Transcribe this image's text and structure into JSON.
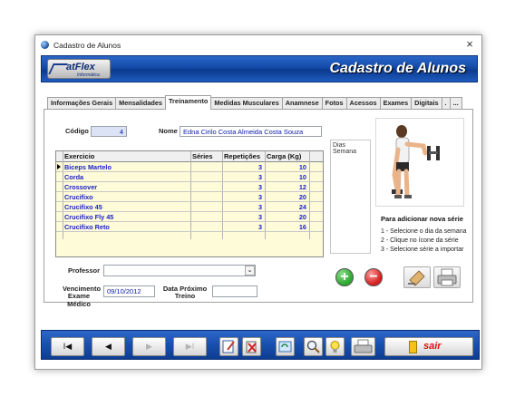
{
  "window": {
    "title": "Cadastro de Alunos",
    "close_glyph": "×"
  },
  "banner": {
    "logo_text": "atFlex",
    "logo_sub": "Informática",
    "title": "Cadastro de Alunos"
  },
  "tabs": [
    {
      "label": "Informações Gerais",
      "active": false
    },
    {
      "label": "Mensalidades",
      "active": false
    },
    {
      "label": "Treinamento",
      "active": true
    },
    {
      "label": "Medidas Musculares",
      "active": false
    },
    {
      "label": "Anamnese",
      "active": false
    },
    {
      "label": "Fotos",
      "active": false
    },
    {
      "label": "Acessos",
      "active": false
    },
    {
      "label": "Exames",
      "active": false
    },
    {
      "label": "Digitais",
      "active": false
    },
    {
      "label": ".",
      "active": false
    },
    {
      "label": "...",
      "active": false
    }
  ],
  "form": {
    "codigo_label": "Código",
    "codigo_value": "4",
    "nome_label": "Nome",
    "nome_value": "Edna Cirilo Costa Almeida Costa Souza",
    "dias_semana_label": "Dias Semana",
    "professor_label": "Professor",
    "professor_value": "",
    "vencimento_label_1": "Vencimento",
    "vencimento_label_2": "Exame Médico",
    "vencimento_value": "09/10/2012",
    "proximo_label_1": "Data Próximo",
    "proximo_label_2": "Treino",
    "proximo_value": ""
  },
  "grid": {
    "headers": {
      "exercicio": "Exercicio",
      "series": "Séries",
      "repeticoes": "Repetições",
      "carga": "Carga (Kg)"
    },
    "rows": [
      {
        "exercicio": "Biceps Martelo",
        "series": "",
        "repeticoes": "3",
        "carga": "10"
      },
      {
        "exercicio": "Corda",
        "series": "",
        "repeticoes": "3",
        "carga": "10"
      },
      {
        "exercicio": "Crossover",
        "series": "",
        "repeticoes": "3",
        "carga": "12"
      },
      {
        "exercicio": "Crucifixo",
        "series": "",
        "repeticoes": "3",
        "carga": "20"
      },
      {
        "exercicio": "Crucifixo 45",
        "series": "",
        "repeticoes": "3",
        "carga": "24"
      },
      {
        "exercicio": "Crucifixo Fly 45",
        "series": "",
        "repeticoes": "3",
        "carga": "20"
      },
      {
        "exercicio": "Crucifixo Reto",
        "series": "",
        "repeticoes": "3",
        "carga": "16"
      }
    ]
  },
  "info": {
    "title": "Para adicionar nova série",
    "steps": [
      "1 - Selecione o dia da semana",
      "2 - Clique no ícone da série",
      "3 - Selecione série a importar"
    ]
  },
  "actions": {
    "add_glyph": "+",
    "remove_glyph": "−"
  },
  "nav": {
    "first": "I◀",
    "prev": "◀",
    "next": "▶",
    "last": "▶I",
    "exit": "sair"
  },
  "colors": {
    "banner_blue": "#134aa8",
    "grid_bg": "#fefbd9",
    "value_blue": "#1a23c8",
    "add_green": "#2ea82e",
    "remove_red": "#d42020"
  }
}
